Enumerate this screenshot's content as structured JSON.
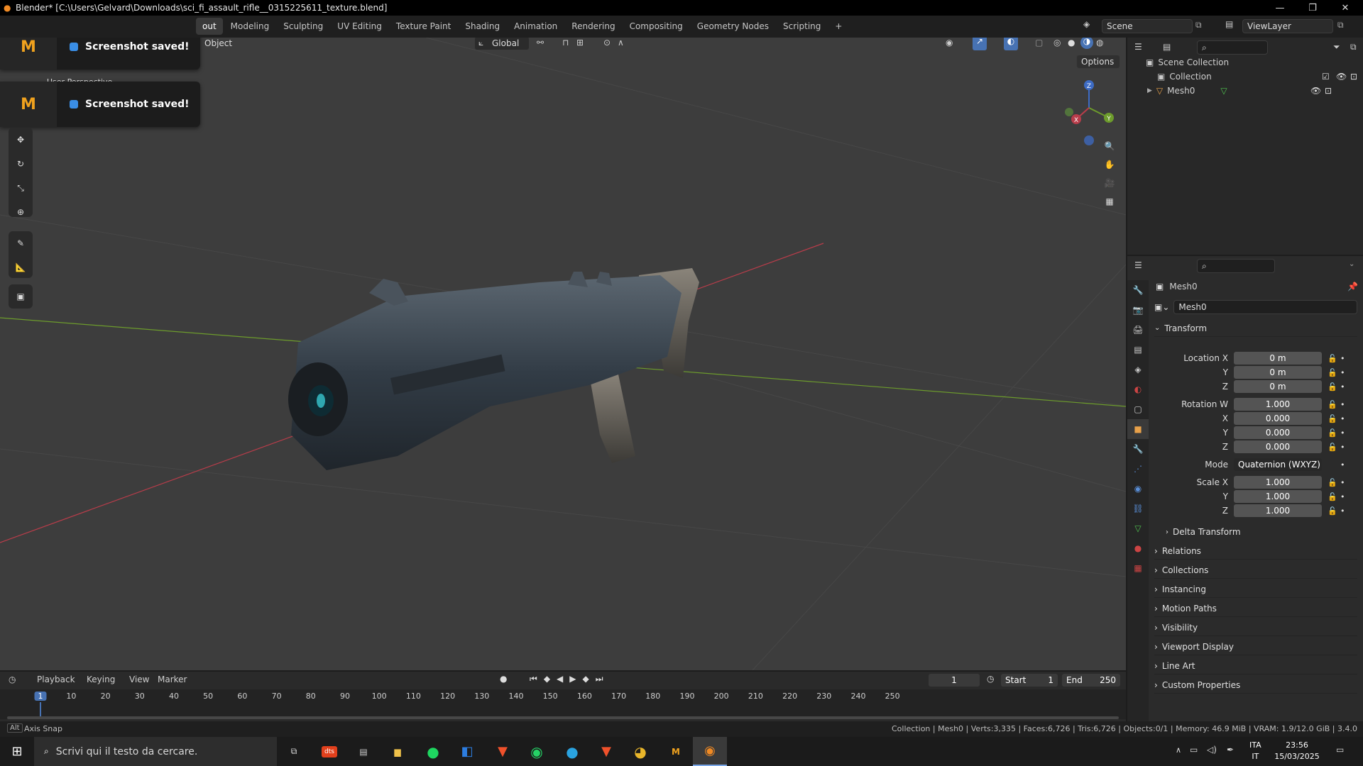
{
  "window": {
    "title": "Blender* [C:\\Users\\Gelvard\\Downloads\\sci_fi_assault_rifle__0315225611_texture.blend]",
    "minimize": "—",
    "restore": "❐",
    "close": "✕"
  },
  "workspaces": [
    "out",
    "Modeling",
    "Sculpting",
    "UV Editing",
    "Texture Paint",
    "Shading",
    "Animation",
    "Rendering",
    "Compositing",
    "Geometry Nodes",
    "Scripting"
  ],
  "add_workspace": "+",
  "scene": {
    "name": "Scene",
    "view_layer": "ViewLayer"
  },
  "viewport": {
    "menu_object": "Object",
    "orientation": "Global",
    "options_label": "Options",
    "partial_text": "User Perspective",
    "toast_text": "Screenshot saved!",
    "gizmo": {
      "x": "X",
      "y": "Y",
      "z": "Z"
    }
  },
  "outliner": {
    "items": [
      {
        "label": "Scene Collection"
      },
      {
        "label": "Collection"
      },
      {
        "label": "Mesh0"
      }
    ]
  },
  "properties": {
    "object_name": "Mesh0",
    "datablock_name": "Mesh0",
    "transform_label": "Transform",
    "location": {
      "label_x": "Location X",
      "x": "0 m",
      "y": "0 m",
      "z": "0 m"
    },
    "rotation": {
      "label_w": "Rotation W",
      "w": "1.000",
      "x": "0.000",
      "y": "0.000",
      "z": "0.000"
    },
    "mode_label": "Mode",
    "mode_value": "Quaternion (WXYZ)",
    "scale": {
      "label_x": "Scale X",
      "x": "1.000",
      "y": "1.000",
      "z": "1.000"
    },
    "axis": {
      "y": "Y",
      "z": "Z",
      "x": "X"
    },
    "delta": "Delta Transform",
    "panels": [
      "Relations",
      "Collections",
      "Instancing",
      "Motion Paths",
      "Visibility",
      "Viewport Display",
      "Line Art",
      "Custom Properties"
    ]
  },
  "timeline": {
    "menus": [
      "Playback",
      "Keying",
      "View",
      "Marker"
    ],
    "current_frame": "1",
    "start_label": "Start",
    "start": "1",
    "end_label": "End",
    "end": "250",
    "ticks": [
      "1",
      "10",
      "20",
      "30",
      "40",
      "50",
      "60",
      "70",
      "80",
      "90",
      "100",
      "110",
      "120",
      "130",
      "140",
      "150",
      "160",
      "170",
      "180",
      "190",
      "200",
      "210",
      "220",
      "230",
      "240",
      "250"
    ]
  },
  "statusbar": {
    "key": "Alt",
    "left": "Axis Snap",
    "right": "Collection | Mesh0 | Verts:3,335 | Faces:6,726 | Tris:6,726 | Objects:0/1 | Memory: 46.9 MiB | VRAM: 1.9/12.0 GiB | 3.4.0"
  },
  "taskbar": {
    "search_placeholder": "Scrivi qui il testo da cercare.",
    "lang": "ITA",
    "lang2": "IT",
    "time": "23:56",
    "date": "15/03/2025",
    "apps": [
      "task-view",
      "dts",
      "file",
      "explorer",
      "spotify",
      "outlook",
      "brave",
      "whatsapp",
      "telegram",
      "brave-alt",
      "chrome",
      "screenshot-app",
      "blender"
    ]
  },
  "colors": {
    "accent": "#4772b3",
    "x_axis": "#b83d4a",
    "y_axis": "#6d9c2c",
    "z_axis": "#3d6bc4",
    "timeline_cursor": "#4772b3"
  }
}
